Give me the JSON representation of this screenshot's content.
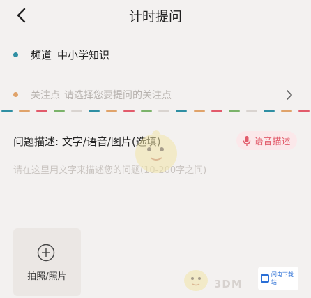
{
  "header": {
    "title": "计时提问"
  },
  "channel": {
    "label": "频道",
    "value": "中小学知识"
  },
  "focus": {
    "label": "关注点",
    "placeholder": "请选择您要提问的关注点"
  },
  "description": {
    "title": "问题描述: 文字/语音/图片(选填)",
    "voice_button": "语音描述",
    "placeholder": "请在这里用文字来描述您的问题(10-200字之间)"
  },
  "photo": {
    "label": "拍照/照片"
  },
  "watermark": {
    "site": "3DM",
    "badge": "闪电下载站"
  },
  "colors": {
    "channel_dot": "#2f8fa3",
    "focus_dot": "#e0a36a",
    "voice_accent": "#e25b6b",
    "dash_palette": [
      "#2f8fa3",
      "#e0a36a",
      "#e25b6b",
      "#7bb36a",
      "#d9d4d0"
    ]
  }
}
